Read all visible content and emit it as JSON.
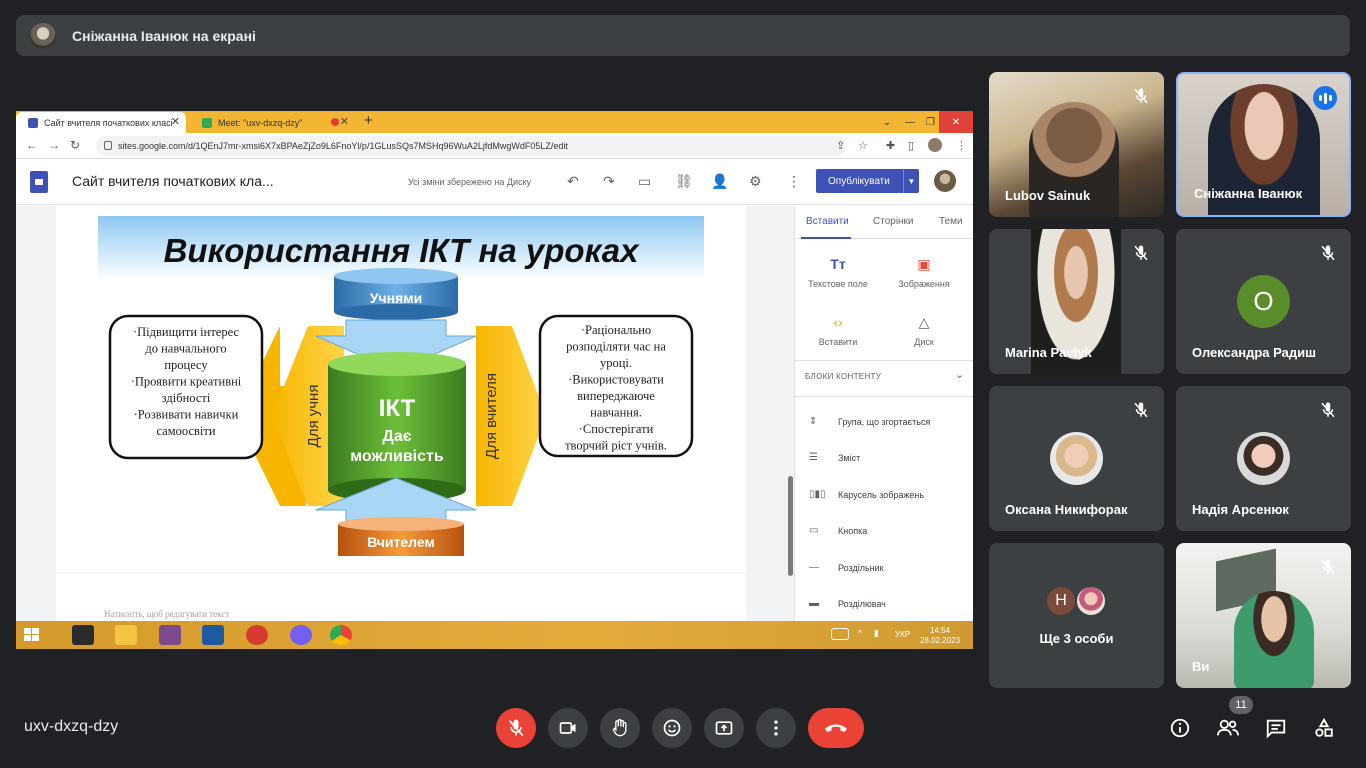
{
  "presenter_banner": {
    "text": "Сніжанна Іванюк на екрані"
  },
  "browser": {
    "tabs": [
      {
        "title": "Сайт вчителя початкових класі",
        "active": true
      },
      {
        "title": "Meet: \"uxv-dxzq-dzy\"",
        "active": false
      }
    ],
    "url": "sites.google.com/d/1QEnJ7mr-xmsi6X7xBPAeZjZo9L6FnoYl/p/1GLusSQs7MSHq96WuA2LjfdMwgWdF05LZ/edit"
  },
  "sites": {
    "title": "Сайт вчителя початкових кла...",
    "saved_status": "Усі зміни збережено на Диску",
    "publish_label": "Опублікувати",
    "edit_hint": "Натисніть, щоб редагувати текст",
    "slide": {
      "heading": "Використання ІКТ на уроках",
      "top_cylinder": "Учнями",
      "bottom_cylinder": "Вчителем",
      "center": [
        "ІКТ",
        "Дає",
        "можливість"
      ],
      "left_arrow": "Для учня",
      "right_arrow": "Для вчителя",
      "left_box": [
        "·Підвищити інтерес",
        "до навчального",
        "процесу",
        "·Проявити креативні",
        "здібності",
        "·Розвивати навички",
        "самоосвіти"
      ],
      "right_box": [
        "·Раціонально",
        "розподіляти час на",
        "уроці.",
        "·Використовувати",
        "випереджаюче",
        "навчання.",
        "·Спостерігати",
        "творчий ріст учнів."
      ]
    },
    "panel": {
      "tabs": [
        "Вставити",
        "Сторінки",
        "Теми"
      ],
      "tools": [
        {
          "label": "Текстове поле",
          "icon": "text-box-icon"
        },
        {
          "label": "Зображення",
          "icon": "image-icon"
        },
        {
          "label": "Вставити",
          "icon": "embed-icon"
        },
        {
          "label": "Диск",
          "icon": "drive-icon"
        }
      ],
      "blocks_header": "БЛОКИ КОНТЕНТУ",
      "blocks": [
        {
          "label": "Група, що згортається",
          "icon": "collapsible-icon"
        },
        {
          "label": "Зміст",
          "icon": "toc-icon"
        },
        {
          "label": "Карусель зображень",
          "icon": "carousel-icon"
        },
        {
          "label": "Кнопка",
          "icon": "button-icon"
        },
        {
          "label": "Роздільник",
          "icon": "divider-icon"
        },
        {
          "label": "Розділювач",
          "icon": "spacer-icon"
        }
      ]
    }
  },
  "taskbar": {
    "language": "УКР",
    "time": "14:54",
    "date": "28.02.2023"
  },
  "participants": [
    {
      "name": "Lubov Sainuk",
      "muted": true,
      "type": "video"
    },
    {
      "name": "Сніжанна Іванюк",
      "muted": false,
      "speaking": true,
      "type": "video"
    },
    {
      "name": "Marina Pavlyk",
      "muted": true,
      "type": "video"
    },
    {
      "name": "Олександра Радиш",
      "muted": true,
      "type": "letter",
      "letter": "О"
    },
    {
      "name": "Оксана Никифорак",
      "muted": true,
      "type": "photo"
    },
    {
      "name": "Надія Арсенюк",
      "muted": true,
      "type": "photo"
    },
    {
      "name": "Ще 3 особи",
      "type": "more",
      "letter": "Н"
    },
    {
      "name": "Ви",
      "muted": true,
      "type": "video"
    }
  ],
  "meeting_code": "uxv-dxzq-dzy",
  "participant_count": "11",
  "colors": {
    "background": "#202124",
    "tile": "#3c4043",
    "red": "#ea4335",
    "accent": "#1a73e8"
  }
}
